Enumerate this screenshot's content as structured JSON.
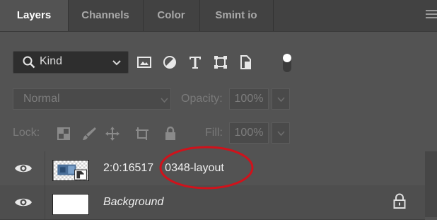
{
  "tabs": [
    {
      "label": "Layers",
      "active": true
    },
    {
      "label": "Channels",
      "active": false
    },
    {
      "label": "Color",
      "active": false
    },
    {
      "label": "Smint io",
      "active": false
    }
  ],
  "filter": {
    "kind_label": "Kind",
    "icons": [
      "image-filter-icon",
      "adjustment-filter-icon",
      "type-filter-icon",
      "shape-filter-icon",
      "smart-object-filter-icon",
      "filter-toggle"
    ]
  },
  "blend": {
    "mode": "Normal",
    "opacity_label": "Opacity:",
    "opacity_value": "100%"
  },
  "lock": {
    "label": "Lock:",
    "fill_label": "Fill:",
    "fill_value": "100%"
  },
  "layers": [
    {
      "name": "2:0:16517 0348-layout",
      "type": "smart-object",
      "visible": true,
      "locked": false
    },
    {
      "name": "Background",
      "type": "background",
      "visible": true,
      "locked": true
    }
  ],
  "colors": {
    "panel_bg": "#535353",
    "tab_bar_bg": "#424242",
    "annotation_red": "#d0121b"
  }
}
